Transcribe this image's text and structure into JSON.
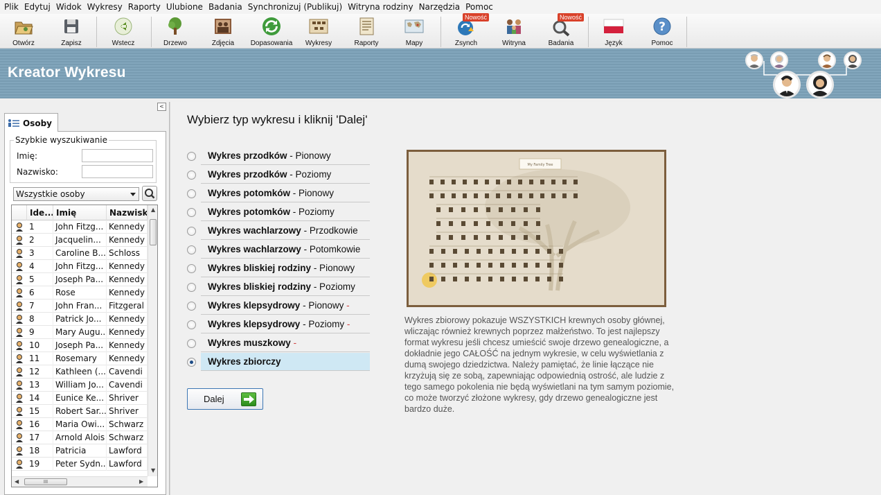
{
  "menu": [
    "Plik",
    "Edytuj",
    "Widok",
    "Wykresy",
    "Raporty",
    "Ulubione",
    "Badania",
    "Synchronizuj (Publikuj)",
    "Witryna rodziny",
    "Narzędzia",
    "Pomoc"
  ],
  "toolbar": {
    "open": "Otwórz",
    "save": "Zapisz",
    "back": "Wstecz",
    "tree": "Drzewo",
    "photos": "Zdjęcia",
    "matches": "Dopasowania",
    "charts": "Wykresy",
    "reports": "Raporty",
    "maps": "Mapy",
    "sync": "Zsynch",
    "site": "Witryna",
    "research": "Badania",
    "language": "Język",
    "help": "Pomoc",
    "new_badge": "Nowość"
  },
  "banner": {
    "title": "Kreator Wykresu"
  },
  "left": {
    "tab": "Osoby",
    "quick_search": {
      "legend": "Szybkie wyszukiwanie",
      "first_name_label": "Imię:",
      "last_name_label": "Nazwisko:",
      "first_name_value": "",
      "last_name_value": ""
    },
    "filter": "Wszystkie osoby",
    "columns": [
      "Ide...",
      "Imię",
      "Nazwisk"
    ],
    "rows": [
      {
        "id": "1",
        "first": "John Fitzg...",
        "last": "Kennedy"
      },
      {
        "id": "2",
        "first": "Jacquelin...",
        "last": "Kennedy"
      },
      {
        "id": "3",
        "first": "Caroline B...",
        "last": "Schloss"
      },
      {
        "id": "4",
        "first": "John Fitzg...",
        "last": "Kennedy"
      },
      {
        "id": "5",
        "first": "Joseph Pa...",
        "last": "Kennedy"
      },
      {
        "id": "6",
        "first": "Rose",
        "last": "Kennedy"
      },
      {
        "id": "7",
        "first": "John Fran...",
        "last": "Fitzgeral"
      },
      {
        "id": "8",
        "first": "Patrick Jo...",
        "last": "Kennedy"
      },
      {
        "id": "9",
        "first": "Mary Augu...",
        "last": "Kennedy"
      },
      {
        "id": "10",
        "first": "Joseph Pa...",
        "last": "Kennedy"
      },
      {
        "id": "11",
        "first": "Rosemary",
        "last": "Kennedy"
      },
      {
        "id": "12",
        "first": "Kathleen (...",
        "last": "Cavendi"
      },
      {
        "id": "13",
        "first": "William Jo...",
        "last": "Cavendi"
      },
      {
        "id": "14",
        "first": "Eunice Ke...",
        "last": "Shriver"
      },
      {
        "id": "15",
        "first": "Robert Sar...",
        "last": "Shriver"
      },
      {
        "id": "16",
        "first": "Maria Owi...",
        "last": "Schwarz"
      },
      {
        "id": "17",
        "first": "Arnold Alois",
        "last": "Schwarz"
      },
      {
        "id": "18",
        "first": "Patricia",
        "last": "Lawford"
      },
      {
        "id": "19",
        "first": "Peter Sydn...",
        "last": "Lawford"
      }
    ],
    "hscroll_label": "III"
  },
  "main": {
    "heading": "Wybierz typ wykresu i kliknij 'Dalej'",
    "options": [
      {
        "bold": "Wykres przodków",
        "rest": " - Pionowy",
        "dash": "",
        "selected": false
      },
      {
        "bold": "Wykres przodków",
        "rest": " - Poziomy",
        "dash": "",
        "selected": false
      },
      {
        "bold": "Wykres potomków",
        "rest": " - Pionowy",
        "dash": "",
        "selected": false
      },
      {
        "bold": "Wykres potomków",
        "rest": " - Poziomy",
        "dash": "",
        "selected": false
      },
      {
        "bold": "Wykres wachlarzowy",
        "rest": " - Przodkowie",
        "dash": "",
        "selected": false
      },
      {
        "bold": "Wykres wachlarzowy",
        "rest": " - Potomkowie",
        "dash": "",
        "selected": false
      },
      {
        "bold": "Wykres bliskiej rodziny",
        "rest": " - Pionowy",
        "dash": "",
        "selected": false
      },
      {
        "bold": "Wykres bliskiej rodziny",
        "rest": " - Poziomy",
        "dash": "",
        "selected": false
      },
      {
        "bold": "Wykres klepsydrowy",
        "rest": " - Pionowy",
        "dash": " -",
        "selected": false
      },
      {
        "bold": "Wykres klepsydrowy",
        "rest": " - Poziomy",
        "dash": " -",
        "selected": false
      },
      {
        "bold": "Wykres muszkowy",
        "rest": "",
        "dash": " -",
        "selected": false
      },
      {
        "bold": "Wykres zbiorczy",
        "rest": "",
        "dash": "",
        "selected": true
      }
    ],
    "next_button": "Dalej",
    "preview_title": "My Family Tree",
    "description": "Wykres zbiorowy pokazuje WSZYSTKICH krewnych osoby głównej, wliczając również krewnych poprzez małżeństwo. To jest najlepszy format wykresu jeśli chcesz umieścić swoje drzewo genealogiczne, a dokładnie jego CAŁOŚĆ na jednym wykresie, w celu wyświetlania z dumą swojego dziedzictwa. Należy pamiętać, że linie łączące nie krzyżują się ze sobą, zapewniając odpowiednią ostrość, ale ludzie z tego samego pokolenia nie będą wyświetlani na tym samym poziomie, co może tworzyć złożone wykresy, gdy drzewo genealogiczne jest bardzo duże."
  }
}
